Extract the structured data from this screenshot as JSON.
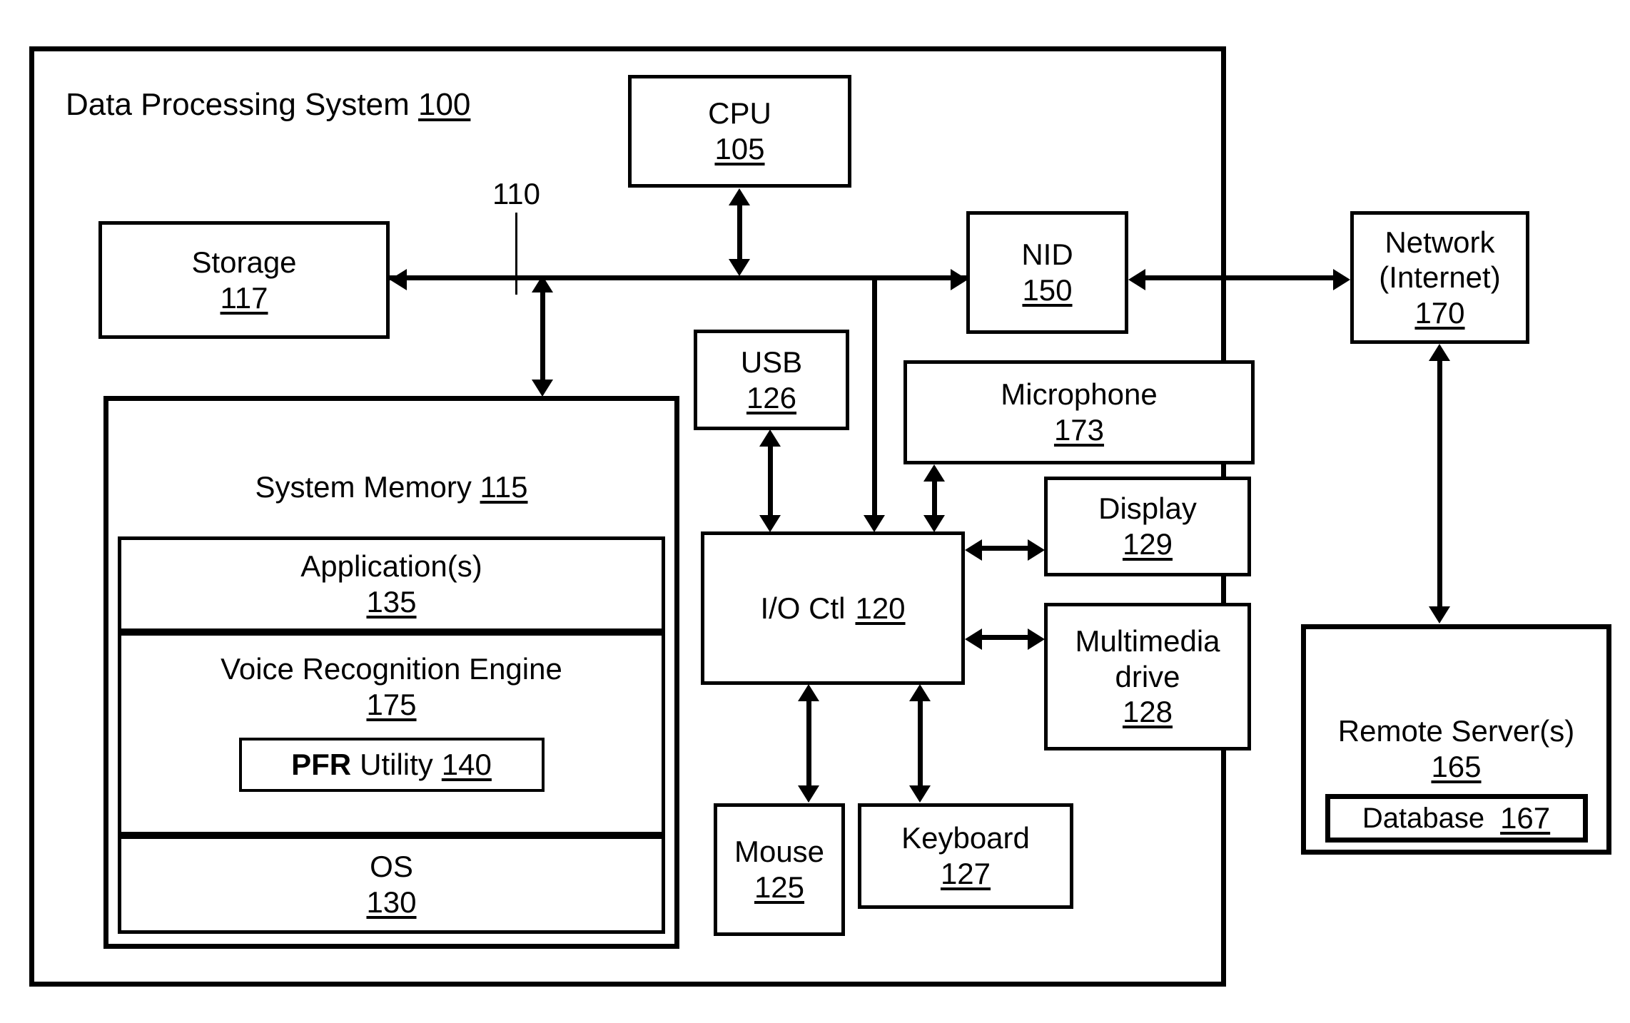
{
  "diagram": {
    "title_label": "Data Processing System",
    "title_ref": "100",
    "bus_ref": "110",
    "blocks": {
      "cpu": {
        "label": "CPU",
        "ref": "105"
      },
      "storage": {
        "label": "Storage",
        "ref": "117"
      },
      "nid": {
        "label": "NID",
        "ref": "150"
      },
      "network": {
        "label": "Network",
        "label2": "(Internet)",
        "ref": "170"
      },
      "usb": {
        "label": "USB",
        "ref": "126"
      },
      "microphone": {
        "label": "Microphone",
        "ref": "173"
      },
      "display": {
        "label": "Display",
        "ref": "129"
      },
      "multimedia": {
        "label": "Multimedia",
        "label2": "drive",
        "ref": "128"
      },
      "ioctl": {
        "label": "I/O Ctl",
        "ref": "120"
      },
      "mouse": {
        "label": "Mouse",
        "ref": "125"
      },
      "keyboard": {
        "label": "Keyboard",
        "ref": "127"
      },
      "remote": {
        "label": "Remote Server(s)",
        "ref": "165"
      },
      "database": {
        "label": "Database",
        "ref": "167"
      },
      "sysmem": {
        "label": "System Memory",
        "ref": "115"
      },
      "apps": {
        "label": "Application(s)",
        "ref": "135"
      },
      "vre": {
        "label": "Voice Recognition Engine",
        "ref": "175"
      },
      "pfr": {
        "label_bold": "PFR",
        "label": "Utility",
        "ref": "140"
      },
      "os": {
        "label": "OS",
        "ref": "130"
      }
    },
    "colors": {
      "stroke": "#000000",
      "background": "#ffffff"
    }
  }
}
